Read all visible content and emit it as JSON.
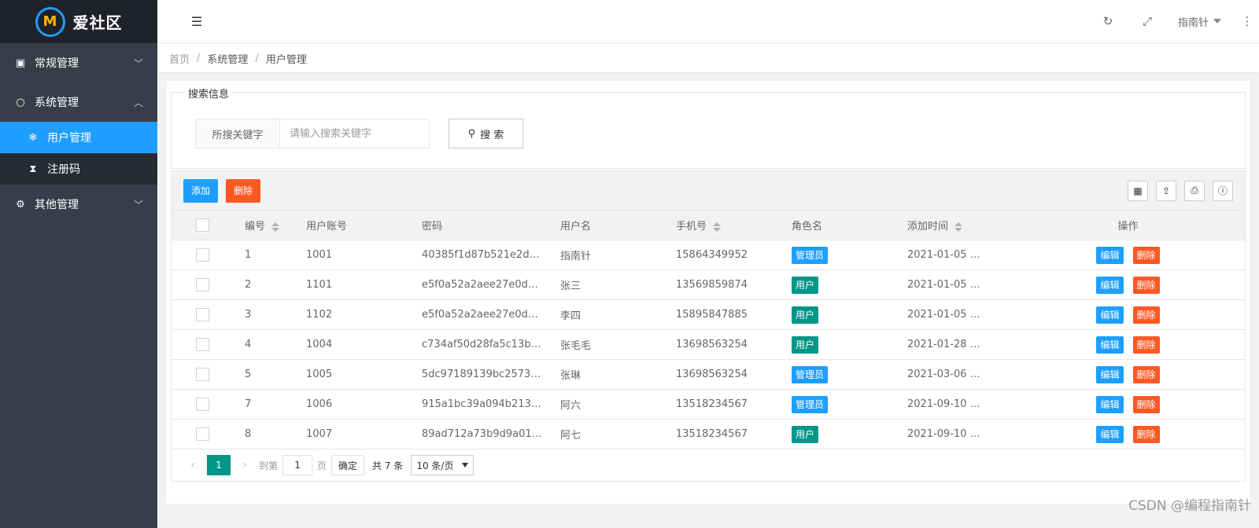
{
  "app": {
    "logo_mark": "M",
    "title": "爱社区"
  },
  "colors": {
    "sidebar_bg": "#393d49",
    "sidebar_dark": "#20222a",
    "accent": "#1E9FFF",
    "danger": "#FF5722",
    "success": "#009688"
  },
  "sidebar": {
    "groups": [
      {
        "label": "常规管理",
        "icon": "contacts-icon"
      },
      {
        "label": "系统管理",
        "icon": "chat-bubble-icon",
        "items": [
          {
            "label": "用户管理",
            "icon": "snowflake-icon",
            "active": true
          },
          {
            "label": "注册码",
            "icon": "hourglass-icon"
          }
        ]
      },
      {
        "label": "其他管理",
        "icon": "gear-icon"
      }
    ]
  },
  "header": {
    "user_name": "指南针"
  },
  "breadcrumb": {
    "home": "首页",
    "section": "系统管理",
    "current": "用户管理",
    "separator": "/"
  },
  "search": {
    "legend": "搜索信息",
    "label": "所搜关键字",
    "placeholder": "请输入搜索关键字",
    "value": "",
    "button": "搜 索"
  },
  "toolbar": {
    "add": "添加",
    "delete": "删除"
  },
  "table": {
    "headers": {
      "id": "编号",
      "account": "用户账号",
      "password": "密码",
      "name": "用户名",
      "phone": "手机号",
      "role": "角色名",
      "time": "添加时间",
      "op": "操作"
    },
    "edit_label": "编辑",
    "delete_label": "删除",
    "rows": [
      {
        "id": "1",
        "account": "1001",
        "password": "40385f1d87b521e2d…",
        "name": "指南针",
        "phone": "15864349952",
        "role": "管理员",
        "time": "2021-01-05 …"
      },
      {
        "id": "2",
        "account": "1101",
        "password": "e5f0a52a2aee27e0d…",
        "name": "张三",
        "phone": "13569859874",
        "role": "用户",
        "time": "2021-01-05 …"
      },
      {
        "id": "3",
        "account": "1102",
        "password": "e5f0a52a2aee27e0d…",
        "name": "李四",
        "phone": "15895847885",
        "role": "用户",
        "time": "2021-01-05 …"
      },
      {
        "id": "4",
        "account": "1004",
        "password": "c734af50d28fa5c13b…",
        "name": "张毛毛",
        "phone": "13698563254",
        "role": "用户",
        "time": "2021-01-28 …"
      },
      {
        "id": "5",
        "account": "1005",
        "password": "5dc97189139bc2573…",
        "name": "张琳",
        "phone": "13698563254",
        "role": "管理员",
        "time": "2021-03-06 …"
      },
      {
        "id": "7",
        "account": "1006",
        "password": "915a1bc39a094b213…",
        "name": "阿六",
        "phone": "13518234567",
        "role": "管理员",
        "time": "2021-09-10 …"
      },
      {
        "id": "8",
        "account": "1007",
        "password": "89ad712a73b9d9a01…",
        "name": "阿七",
        "phone": "13518234567",
        "role": "用户",
        "time": "2021-09-10 …"
      }
    ]
  },
  "pager": {
    "current": "1",
    "goto_prefix": "到第",
    "goto_value": "1",
    "goto_suffix": "页",
    "confirm": "确定",
    "total": "共 7 条",
    "page_size": "10 条/页"
  },
  "watermark": "CSDN @编程指南针"
}
